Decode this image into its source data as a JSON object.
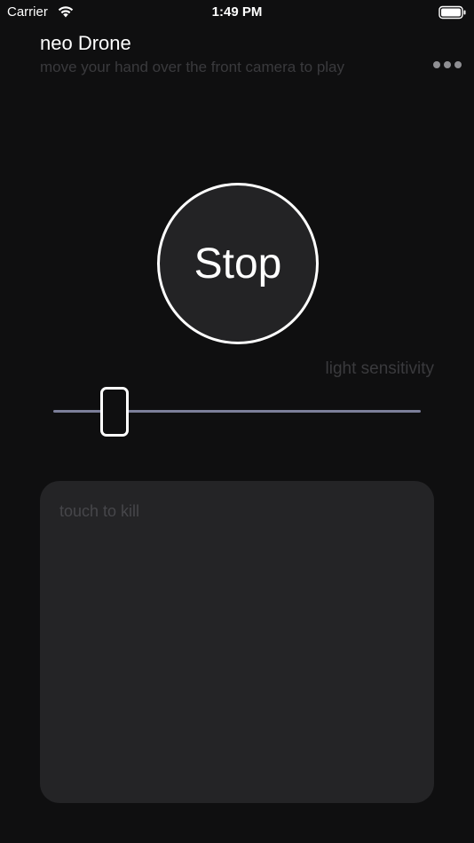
{
  "status_bar": {
    "carrier": "Carrier",
    "time": "1:49 PM",
    "wifi_icon": "wifi-icon",
    "battery_icon": "battery-icon"
  },
  "header": {
    "title": "neo Drone",
    "subtitle": "move your hand over the front camera to play",
    "more_icon": "ellipsis-icon"
  },
  "main": {
    "stop_label": "Stop",
    "sensitivity_label": "light sensitivity",
    "sensitivity_value": 0.14,
    "kill_pad_label": "touch to kill"
  },
  "colors": {
    "background": "#0f0f10",
    "button_fill": "#232325",
    "slider_track": "#7c7f9a",
    "pad_fill": "#242426",
    "muted_text": "#3a3a3d"
  }
}
